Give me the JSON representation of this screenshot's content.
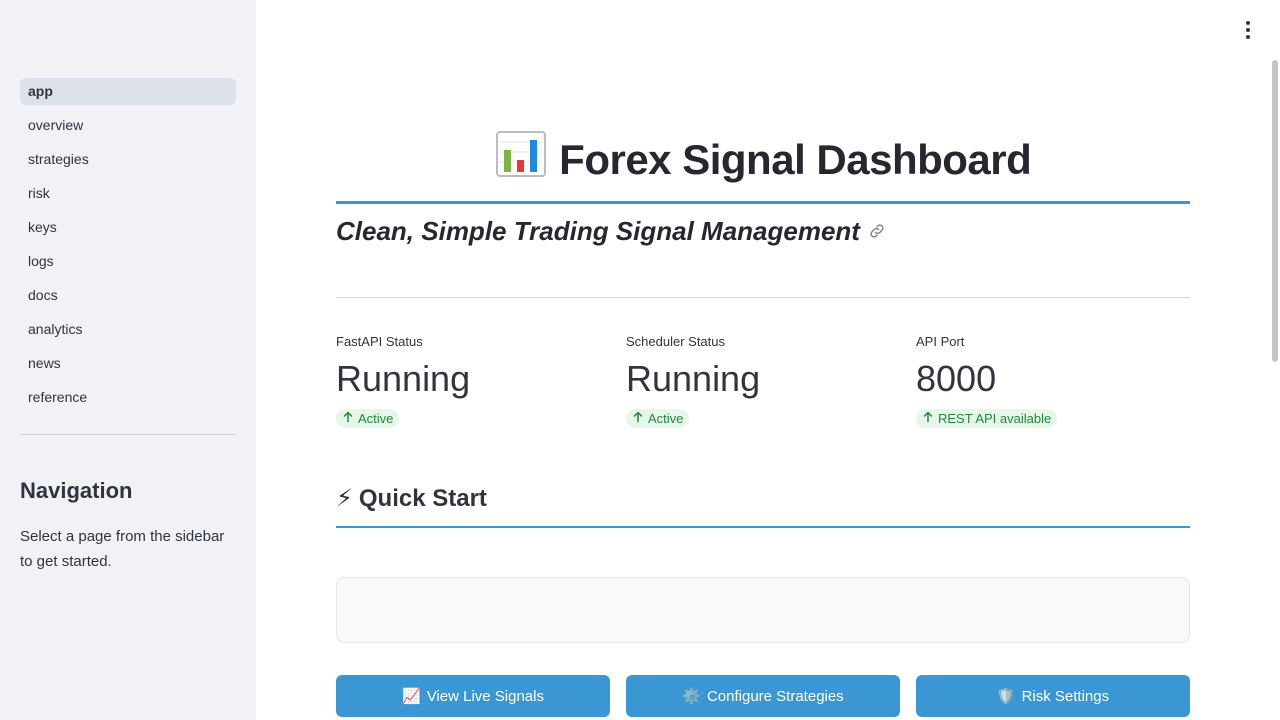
{
  "sidebar": {
    "items": [
      {
        "label": "app",
        "active": true
      },
      {
        "label": "overview"
      },
      {
        "label": "strategies"
      },
      {
        "label": "risk"
      },
      {
        "label": "keys"
      },
      {
        "label": "logs"
      },
      {
        "label": "docs"
      },
      {
        "label": "analytics"
      },
      {
        "label": "news"
      },
      {
        "label": "reference"
      }
    ],
    "heading": "Navigation",
    "text": "Select a page from the sidebar to get started."
  },
  "header": {
    "title_icon": "bar-chart-icon",
    "title": "Forex Signal Dashboard",
    "subtitle": "Clean, Simple Trading Signal Management"
  },
  "metrics": [
    {
      "label": "FastAPI Status",
      "value": "Running",
      "delta": "Active",
      "delta_icon": "arrow-up-icon"
    },
    {
      "label": "Scheduler Status",
      "value": "Running",
      "delta": "Active",
      "delta_icon": "arrow-up-icon"
    },
    {
      "label": "API Port",
      "value": "8000",
      "delta": "REST API available",
      "delta_icon": "arrow-up-icon"
    }
  ],
  "quick_start": {
    "icon": "⚡",
    "heading": "Quick Start"
  },
  "buttons": [
    {
      "icon": "📈",
      "label": "View Live Signals"
    },
    {
      "icon": "⚙️",
      "label": "Configure Strategies"
    },
    {
      "icon": "🛡️",
      "label": "Risk Settings"
    }
  ],
  "colors": {
    "accent": "#3a97d4",
    "sidebar_bg": "#f0f2f6",
    "delta_green": "#21883a",
    "delta_bg": "#e6f6ea"
  }
}
